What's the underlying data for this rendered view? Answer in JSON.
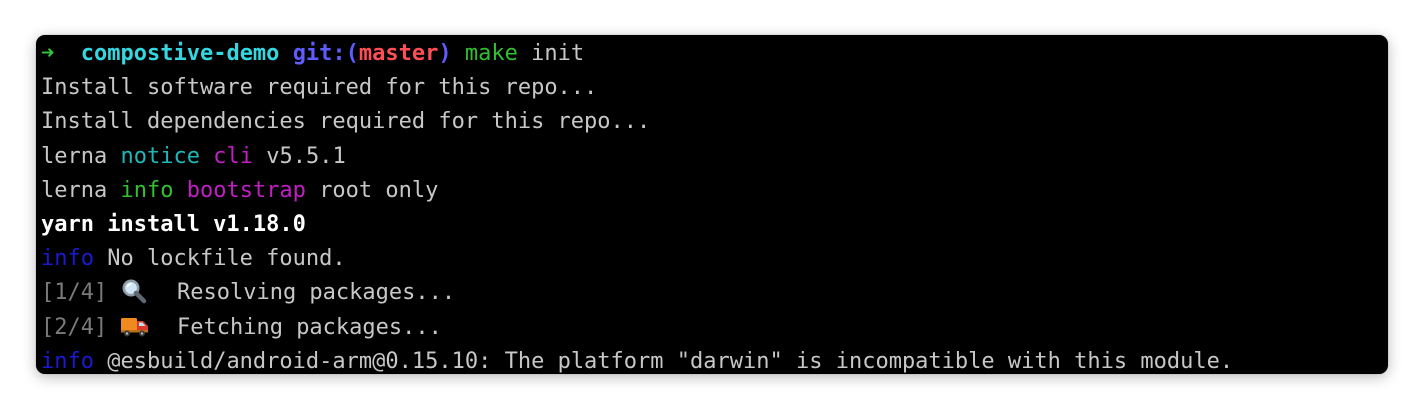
{
  "terminal": {
    "prompt": {
      "arrow": "➜",
      "directory": "compostive-demo",
      "git_prefix": "git:(",
      "branch": "master",
      "git_suffix": ")",
      "command": "make",
      "argument": "init"
    },
    "lines": {
      "l1": "Install software required for this repo...",
      "l2": "Install dependencies required for this repo...",
      "l3": {
        "prefix": "lerna",
        "level": "notice",
        "tag": "cli",
        "text": "v5.5.1"
      },
      "l4": {
        "prefix": "lerna",
        "level": "info",
        "tag": "bootstrap",
        "text": "root only"
      },
      "l5": "yarn install v1.18.0",
      "l6": {
        "level": "info",
        "text": "No lockfile found."
      },
      "l7": {
        "step": "[1/4]",
        "icon": "magnifying-glass-icon",
        "text": "Resolving packages..."
      },
      "l8": {
        "step": "[2/4]",
        "icon": "delivery-truck-icon",
        "text": "Fetching packages..."
      },
      "l9": {
        "level": "info",
        "text": "@esbuild/android-arm@0.15.10: The platform \"darwin\" is incompatible with this module."
      }
    },
    "colors": {
      "background": "#000000",
      "text": "#c7c7c7",
      "prompt_arrow": "#34c43a",
      "directory": "#34d6e0",
      "git": "#5c5cff",
      "branch": "#ff4e56",
      "command": "#31c031",
      "notice": "#1fb7b7",
      "tag": "#c21fc2",
      "info": "#1a1ad0",
      "step": "#7a7a7a"
    }
  }
}
